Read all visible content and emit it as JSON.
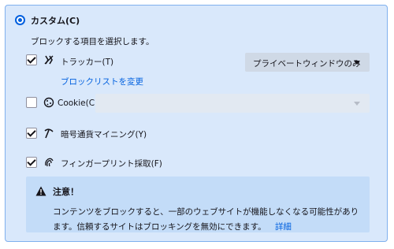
{
  "custom": {
    "label": "カスタム(C)",
    "description": "ブロックする項目を選択します。"
  },
  "options": {
    "trackers": {
      "label": "トラッカー(T)",
      "checked": true,
      "dropdown_value": "プライベートウィンドウのみ",
      "link": "ブロックリストを変更"
    },
    "cookie": {
      "label": "Cookie(C)",
      "checked": false
    },
    "cryptominers": {
      "label": "暗号通貨マイニング(Y)",
      "checked": true
    },
    "fingerprinters": {
      "label": "フィンガープリント採取(F)",
      "checked": true
    }
  },
  "warning": {
    "title": "注意！",
    "body": "コンテンツをブロックすると、一部のウェブサイトが機能しなくなる可能性があります。信頼するサイトはブロッキングを無効にできます。",
    "link": "詳細"
  },
  "colors": {
    "accent": "#0060df",
    "panel_bg": "#d9e8fb",
    "warning_bg": "#c3dcf8"
  }
}
